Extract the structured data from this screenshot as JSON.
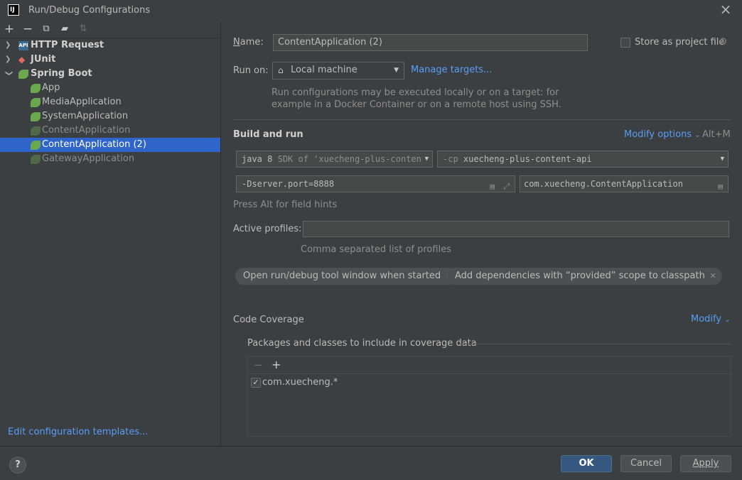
{
  "window": {
    "title": "Run/Debug Configurations",
    "app_icon": "IJ"
  },
  "tree": {
    "groups": [
      {
        "label": "HTTP Request",
        "icon": "http-icon"
      },
      {
        "label": "JUnit",
        "icon": "junit-icon"
      },
      {
        "label": "Spring Boot",
        "icon": "spring-icon"
      }
    ],
    "items": [
      {
        "label": "App"
      },
      {
        "label": "MediaApplication"
      },
      {
        "label": "SystemApplication"
      },
      {
        "label": "ContentApplication"
      },
      {
        "label": "ContentApplication (2)"
      },
      {
        "label": "GatewayApplication"
      }
    ],
    "edit_templates_link": "Edit configuration templates..."
  },
  "form": {
    "name_label": "Name:",
    "name_value": "ContentApplication (2)",
    "store_label": "Store as project file",
    "run_on_label": "Run on:",
    "run_on_value": "Local machine",
    "manage_targets": "Manage targets...",
    "run_on_hint_1": "Run configurations may be executed locally or on a target: for",
    "run_on_hint_2": "example in a Docker Container or on a remote host using SSH.",
    "build_and_run": "Build and run",
    "modify_options": "Modify options",
    "modify_shortcut": "Alt+M",
    "jdk_main": "java 8",
    "jdk_sub": "SDK of 'xuecheng-plus-content",
    "cp_prefix": "-cp",
    "cp_value": "xuecheng-plus-content-api",
    "vm_options": "-Dserver.port=8888",
    "main_class": "com.xuecheng.ContentApplication",
    "field_hints": "Press Alt for field hints",
    "active_profiles_label": "Active profiles:",
    "active_profiles_value": "",
    "profiles_hint": "Comma separated list of profiles",
    "tags": [
      "Open run/debug tool window when started",
      "Add dependencies with “provided” scope to classpath"
    ],
    "code_coverage": "Code Coverage",
    "modify": "Modify",
    "coverage_packages_label": "Packages and classes to include in coverage data",
    "coverage_pattern": "com.xuecheng.*"
  },
  "buttons": {
    "help": "?",
    "ok": "OK",
    "cancel": "Cancel",
    "apply": "Apply"
  },
  "colors": {
    "background": "#3c3f41",
    "selection": "#2f65ca",
    "link": "#589df6",
    "primary_button": "#365880"
  }
}
